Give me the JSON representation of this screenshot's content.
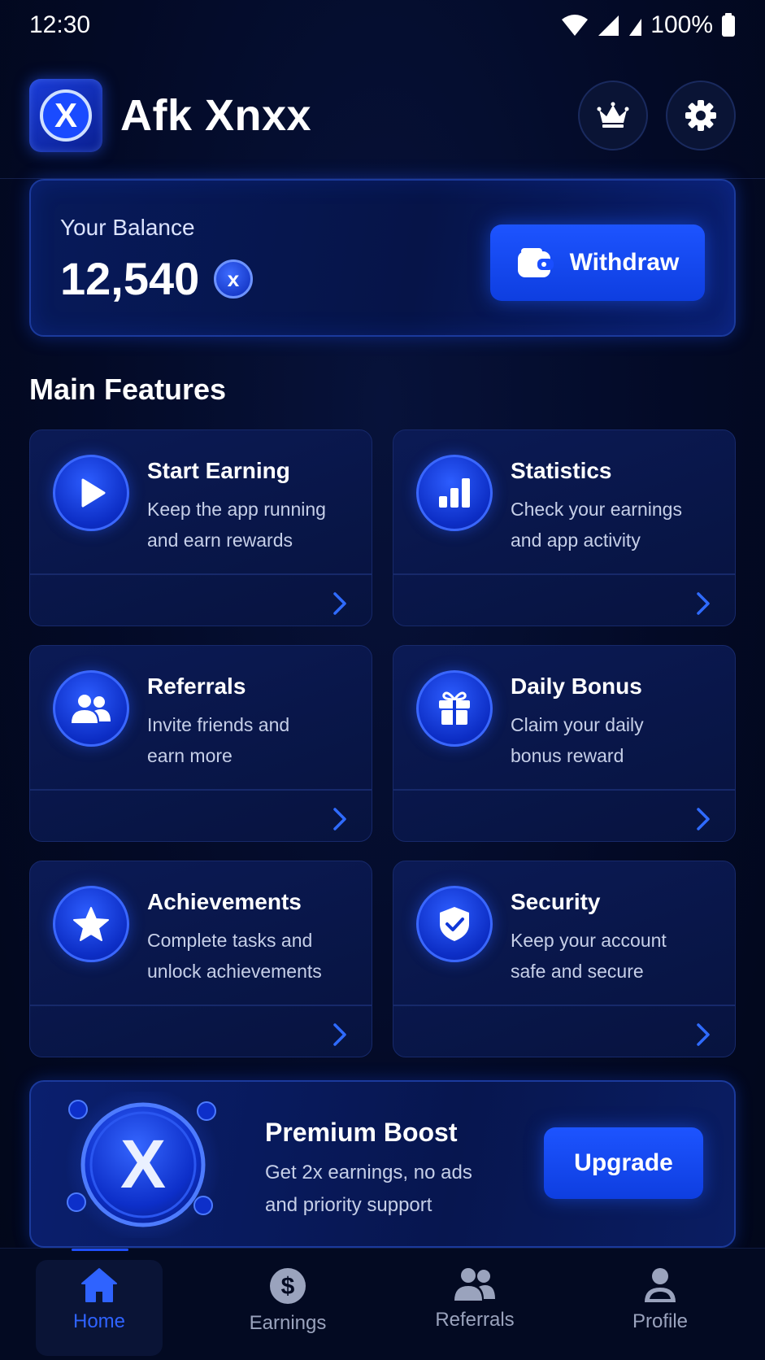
{
  "status_bar": {
    "time": "12:30",
    "battery": "100%"
  },
  "header": {
    "title": "Afk Xnxx",
    "logo_letter": "X"
  },
  "balance": {
    "label": "Your Balance",
    "value": "12,540",
    "coin_letter": "x",
    "withdraw_label": "Withdraw"
  },
  "main_features": {
    "title": "Main Features",
    "items": [
      {
        "title": "Start Earning",
        "desc_line1": "Keep the app running",
        "desc_line2": "and earn rewards",
        "icon": "play-icon"
      },
      {
        "title": "Statistics",
        "desc_line1": "Check your earnings",
        "desc_line2": "and app activity",
        "icon": "bar-chart-icon"
      },
      {
        "title": "Referrals",
        "desc_line1": "Invite friends and",
        "desc_line2": "earn more",
        "icon": "users-icon"
      },
      {
        "title": "Daily Bonus",
        "desc_line1": "Claim your daily",
        "desc_line2": "bonus reward",
        "icon": "gift-icon"
      },
      {
        "title": "Achievements",
        "desc_line1": "Complete tasks and",
        "desc_line2": "unlock achievements",
        "icon": "star-icon"
      },
      {
        "title": "Security",
        "desc_line1": "Keep your account",
        "desc_line2": "safe and secure",
        "icon": "shield-check-icon"
      }
    ]
  },
  "premium": {
    "title": "Premium Boost",
    "desc_line1": "Get 2x earnings, no ads",
    "desc_line2": "and priority support",
    "button_label": "Upgrade",
    "coin_letter": "X"
  },
  "bottom_nav": {
    "items": [
      {
        "label": "Home",
        "icon": "home-icon",
        "active": true
      },
      {
        "label": "Earnings",
        "icon": "dollar-icon",
        "active": false
      },
      {
        "label": "Referrals",
        "icon": "users-icon",
        "active": false
      },
      {
        "label": "Profile",
        "icon": "user-icon",
        "active": false
      }
    ]
  },
  "colors": {
    "accent": "#1d54ff",
    "background": "#030a26",
    "card": "#0b1a55",
    "nav_active": "#2f63ff",
    "nav_inactive": "#9aa3bd"
  }
}
